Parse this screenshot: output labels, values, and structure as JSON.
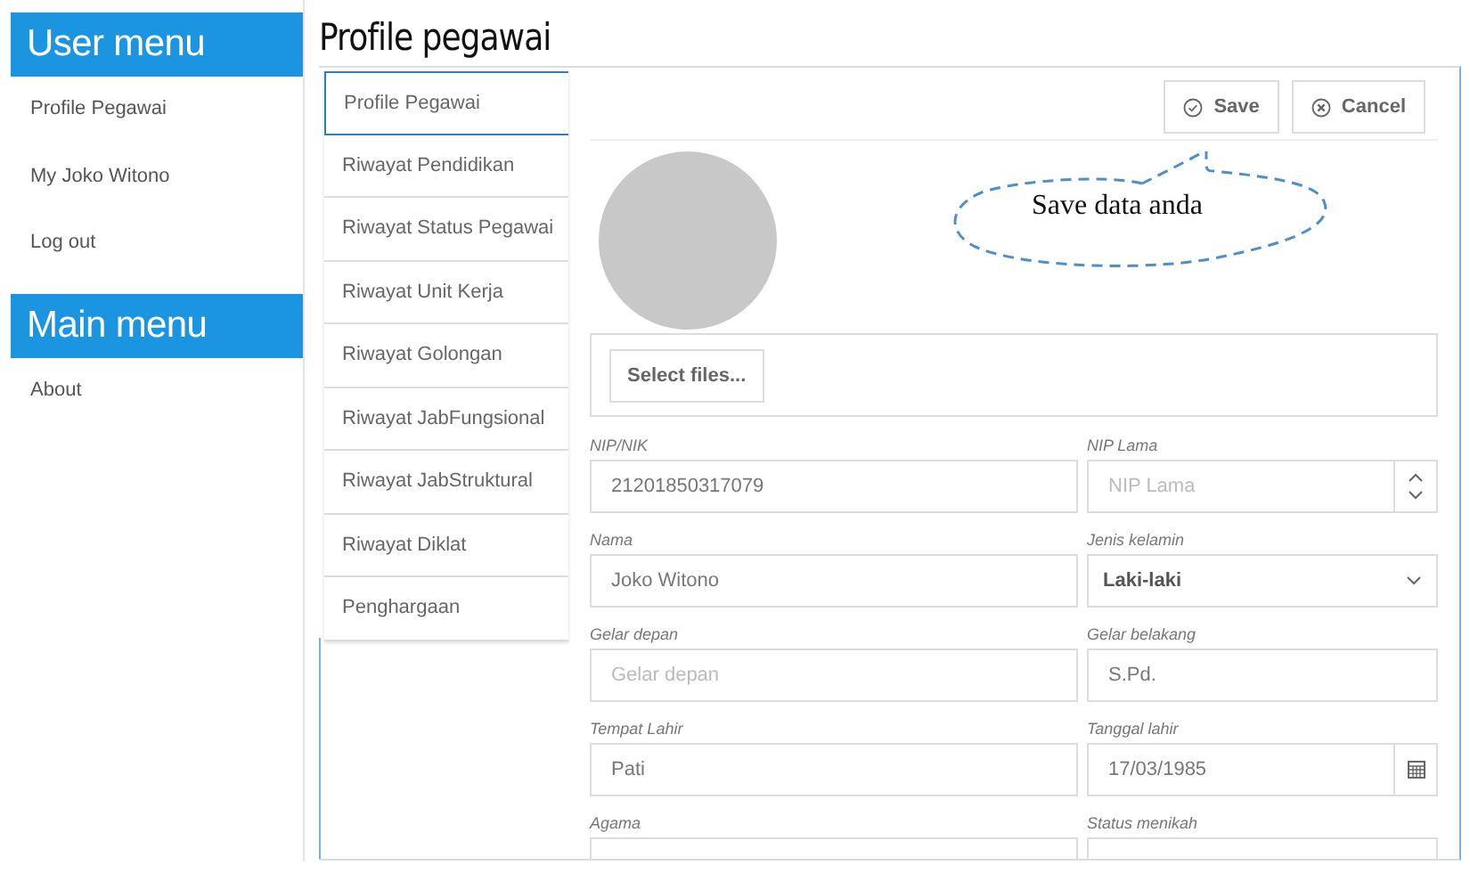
{
  "sidebar": {
    "sections": [
      {
        "title": "User menu",
        "items": [
          {
            "label": "Profile Pegawai"
          },
          {
            "label": "My Joko Witono"
          },
          {
            "label": "Log out"
          }
        ]
      },
      {
        "title": "Main menu",
        "items": [
          {
            "label": "About"
          }
        ]
      }
    ]
  },
  "page": {
    "title": "Profile pegawai"
  },
  "tabs": [
    {
      "label": "Profile Pegawai",
      "selected": true
    },
    {
      "label": "Riwayat Pendidikan",
      "selected": false
    },
    {
      "label": "Riwayat Status Pegawai",
      "selected": false
    },
    {
      "label": "Riwayat Unit Kerja",
      "selected": false
    },
    {
      "label": "Riwayat Golongan",
      "selected": false
    },
    {
      "label": "Riwayat JabFungsional",
      "selected": false
    },
    {
      "label": "Riwayat JabStruktural",
      "selected": false
    },
    {
      "label": "Riwayat Diklat",
      "selected": false
    },
    {
      "label": "Penghargaan",
      "selected": false
    }
  ],
  "toolbar": {
    "buttons": [
      {
        "label": "Save",
        "kind": "save"
      },
      {
        "label": "Cancel",
        "kind": "cancel"
      }
    ]
  },
  "callout": {
    "text": "Save data anda"
  },
  "upload": {
    "button": "Select files..."
  },
  "fields": [
    {
      "label": "NIP/NIK",
      "kind": "text",
      "value": "21201850317079"
    },
    {
      "label": "NIP Lama",
      "kind": "number",
      "placeholder": "NIP Lama"
    },
    {
      "label": "Nama",
      "kind": "text",
      "value": "Joko Witono"
    },
    {
      "label": "Jenis kelamin",
      "kind": "select",
      "value": "Laki-laki"
    },
    {
      "label": "Gelar depan",
      "kind": "text",
      "placeholder": "Gelar depan"
    },
    {
      "label": "Gelar belakang",
      "kind": "text",
      "value": "S.Pd."
    },
    {
      "label": "Tempat Lahir",
      "kind": "text",
      "value": "Pati"
    },
    {
      "label": "Tanggal lahir",
      "kind": "date",
      "value": "17/03/1985"
    },
    {
      "label": "Agama",
      "kind": "text"
    },
    {
      "label": "Status menikah",
      "kind": "text"
    }
  ]
}
